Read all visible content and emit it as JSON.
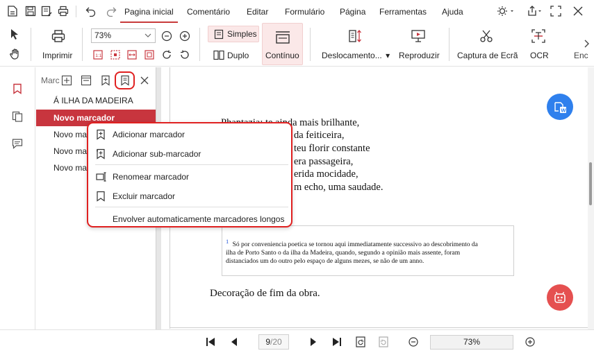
{
  "menubar": {
    "tabs": [
      "Pagina inicial",
      "Comentário",
      "Editar",
      "Formulário",
      "Página",
      "Ferramentas",
      "Ajuda"
    ],
    "active_tab": "Pagina inicial"
  },
  "ribbon": {
    "print_label": "Imprimir",
    "zoom_value": "73%",
    "simples_label": "Simples",
    "duplo_label": "Duplo",
    "continuo_label": "Contínuo",
    "deslocamento_label": "Deslocamento...",
    "reproduzir_label": "Reproduzir",
    "captura_label": "Captura de Ecrã",
    "ocr_label": "OCR",
    "enc_label": "Enc"
  },
  "panel": {
    "header_label": "Marc",
    "bookmarks": [
      {
        "label": "Á ILHA DA MADEIRA",
        "selected": false
      },
      {
        "label": "Novo marcador",
        "selected": true
      },
      {
        "label": "Novo ma",
        "selected": false
      },
      {
        "label": "Novo ma",
        "selected": false
      },
      {
        "label": "Novo ma",
        "selected": false
      }
    ]
  },
  "context_menu": {
    "items": [
      {
        "label": "Adicionar marcador",
        "icon": "bookmark-add-icon"
      },
      {
        "label": "Adicionar sub-marcador",
        "icon": "sub-bookmark-add-icon"
      },
      {
        "label": "Renomear marcador",
        "icon": "rename-icon"
      },
      {
        "label": "Excluir marcador",
        "icon": "bookmark-delete-icon"
      },
      {
        "label": "Envolver automaticamente marcadores longos",
        "icon": ""
      }
    ]
  },
  "document": {
    "poem_lines": [
      "Phantazia: te ainda mais brilhante,",
      "da feiticeira,",
      "teu florir constante",
      "era passageira,",
      "erida mocidade,",
      "m echo, uma saudade."
    ],
    "footnote_mark": "1",
    "footnote_lines": [
      "Só por conveniencia poetica se tornou aqui immediatamente successivo ao descobrimento da",
      "ilha de Porto Santo o da ilha da Madeira, quando, segundo a opinião mais assente, foram",
      "distanciados um do outro pelo espaço de alguns mezes, se não de um anno."
    ],
    "closing_text": "Decoração de fim da obra."
  },
  "statusbar": {
    "page_current": "9",
    "page_total": "/20",
    "zoom": "73%"
  },
  "colors": {
    "accent": "#c8353e",
    "highlight_outline": "#e02020",
    "selected_bg": "#fbe8e8",
    "fab_blue": "#2f80ed",
    "fab_red": "#e55050"
  }
}
